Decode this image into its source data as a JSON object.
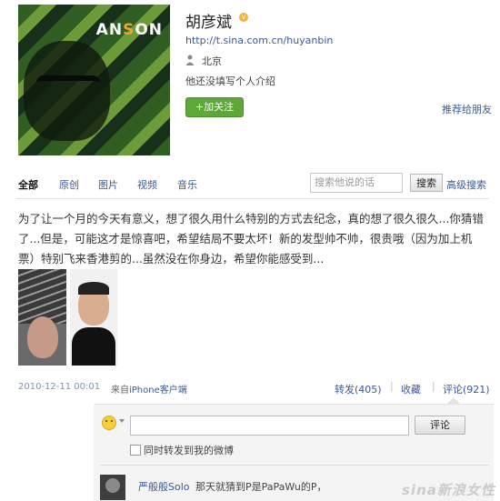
{
  "avatar": {
    "logo_text_1": "A",
    "logo_text_2": "N",
    "logo_text_3": "S",
    "logo_text_4": "O",
    "logo_text_5": "N"
  },
  "profile": {
    "name": "胡彦斌",
    "url": "http://t.sina.com.cn/huyanbin",
    "location": "北京",
    "bio": "他还没填写个人介绍",
    "follow_label": "+加关注",
    "recommend_label": "推荐给朋友"
  },
  "tabs": [
    "全部",
    "原创",
    "图片",
    "视频",
    "音乐"
  ],
  "search": {
    "placeholder": "搜索他说的话",
    "button_label": "搜索",
    "advanced_label": "高级搜索"
  },
  "post": {
    "text": "为了让一个月的今天有意义，想了很久用什么特别的方式去纪念，真的想了很久很久...你猜错了...但是，可能这才是惊喜吧，希望结局不要太坏！新的发型帅不帅，很贵哦（因为加上机票）特别飞来香港剪的...虽然没在你身边，希望你能感受到...",
    "date": "2010-12-11 00:01",
    "source_prefix": "来自",
    "source_link": "iPhone客户端",
    "repost_label": "转发(405)",
    "favorite_label": "收藏",
    "comment_label": "评论(921)"
  },
  "comment_box": {
    "submit_label": "评论",
    "also_repost_label": "同时转发到我的微博"
  },
  "comments": [
    {
      "author": "严般般Solo",
      "text": "那天就猜到P是PaPaWu的P，"
    }
  ],
  "watermark": "sina新浪女性",
  "colors": {
    "link": "#3b5998",
    "follow_button": "#5ea83a",
    "date": "#7d93b5"
  }
}
